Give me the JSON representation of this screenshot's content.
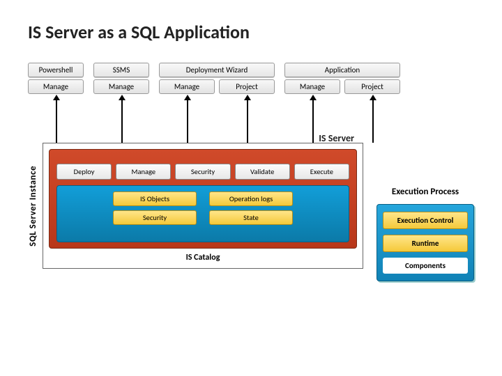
{
  "title": "IS Server as a SQL Application",
  "clients": {
    "powershell": {
      "header": "Powershell",
      "sub": "Manage"
    },
    "ssms": {
      "header": "SSMS",
      "sub": "Manage"
    },
    "wizard": {
      "header": "Deployment Wizard",
      "sub1": "Manage",
      "sub2": "Project"
    },
    "app": {
      "header": "Application",
      "sub1": "Manage",
      "sub2": "Project"
    }
  },
  "instance_label": "SQL Server Instance",
  "isserver_label": "IS Server",
  "actions": [
    "Deploy",
    "Manage",
    "Security",
    "Validate",
    "Execute"
  ],
  "catalog": {
    "label": "IS Catalog",
    "row1": [
      "IS Objects",
      "Operation logs"
    ],
    "row2": [
      "Security",
      "State"
    ]
  },
  "exec": {
    "title": "Execution Process",
    "items": [
      "Execution Control",
      "Runtime",
      "Components"
    ]
  }
}
